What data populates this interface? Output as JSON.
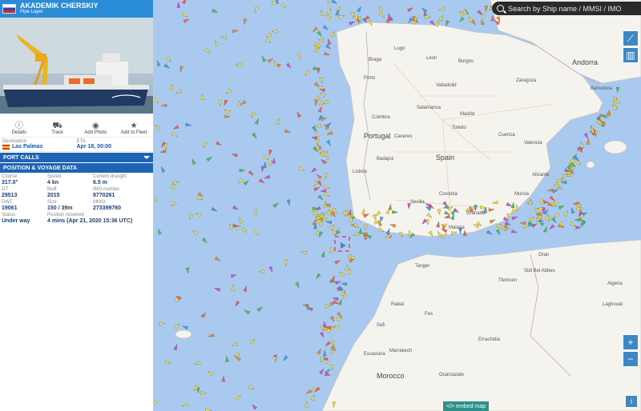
{
  "sidebar": {
    "ship_name": "AKADEMIK CHERSKIY",
    "ship_type": "Pipe Layer",
    "actions": [
      {
        "label": "Details",
        "icon": "info-icon"
      },
      {
        "label": "Track",
        "icon": "truck-icon"
      },
      {
        "label": "Add Photo",
        "icon": "camera-icon"
      },
      {
        "label": "Add to Fleet",
        "icon": "star-icon"
      }
    ],
    "destination_label": "Destination",
    "destination": "Las Palmas",
    "eta_label": "ETA",
    "eta": "Apr 18, 00:00",
    "port_calls": "PORT CALLS",
    "position_voyage": "POSITION & VOYAGE DATA",
    "fields": {
      "course_label": "Course",
      "course": "317.0°",
      "speed_label": "Speed",
      "speed": "4 kn",
      "draught_label": "Current draught",
      "draught": "6.5 m",
      "gt_label": "GT",
      "gt": "29513",
      "built_label": "Built",
      "built": "2015",
      "imo_label": "IMO number",
      "imo": "8770261",
      "dwt_label": "DWT",
      "dwt": "19061",
      "size_label": "Size",
      "size": "150 / 39m",
      "mmsi_label": "MMSI",
      "mmsi": "273399760",
      "status_label": "Status",
      "status": "Under way",
      "received_label": "Position received",
      "received": "4 mins (Apr 21, 2020 15:36 UTC)"
    }
  },
  "map": {
    "search_placeholder": "Search by Ship name / MMSI / IMO",
    "countries": [
      "Portugal",
      "Spain",
      "Andorra",
      "Morocco"
    ],
    "places": [
      "Porto",
      "Braga",
      "Lugo",
      "Leon",
      "Burgos",
      "Zaragoza",
      "Barcelona",
      "Madrid",
      "Toledo",
      "Cuenca",
      "Valencia",
      "Salamanca",
      "Valladolid",
      "Coimbra",
      "Lisboa",
      "Sevilla",
      "Cordoba",
      "Granada",
      "Malaga",
      "Murcia",
      "Alicante",
      "Badajoz",
      "Caceres",
      "Algeria",
      "Rabat",
      "Fes",
      "Tanger",
      "Oran",
      "Sidi Bel Abbes",
      "Tlemcen",
      "Laghouat",
      "Errachidia",
      "Marrakech",
      "Safi",
      "Essaouira",
      "Ouarzazate"
    ],
    "embed_label": "</> embed map",
    "zoom_in": "+",
    "zoom_out": "−"
  }
}
